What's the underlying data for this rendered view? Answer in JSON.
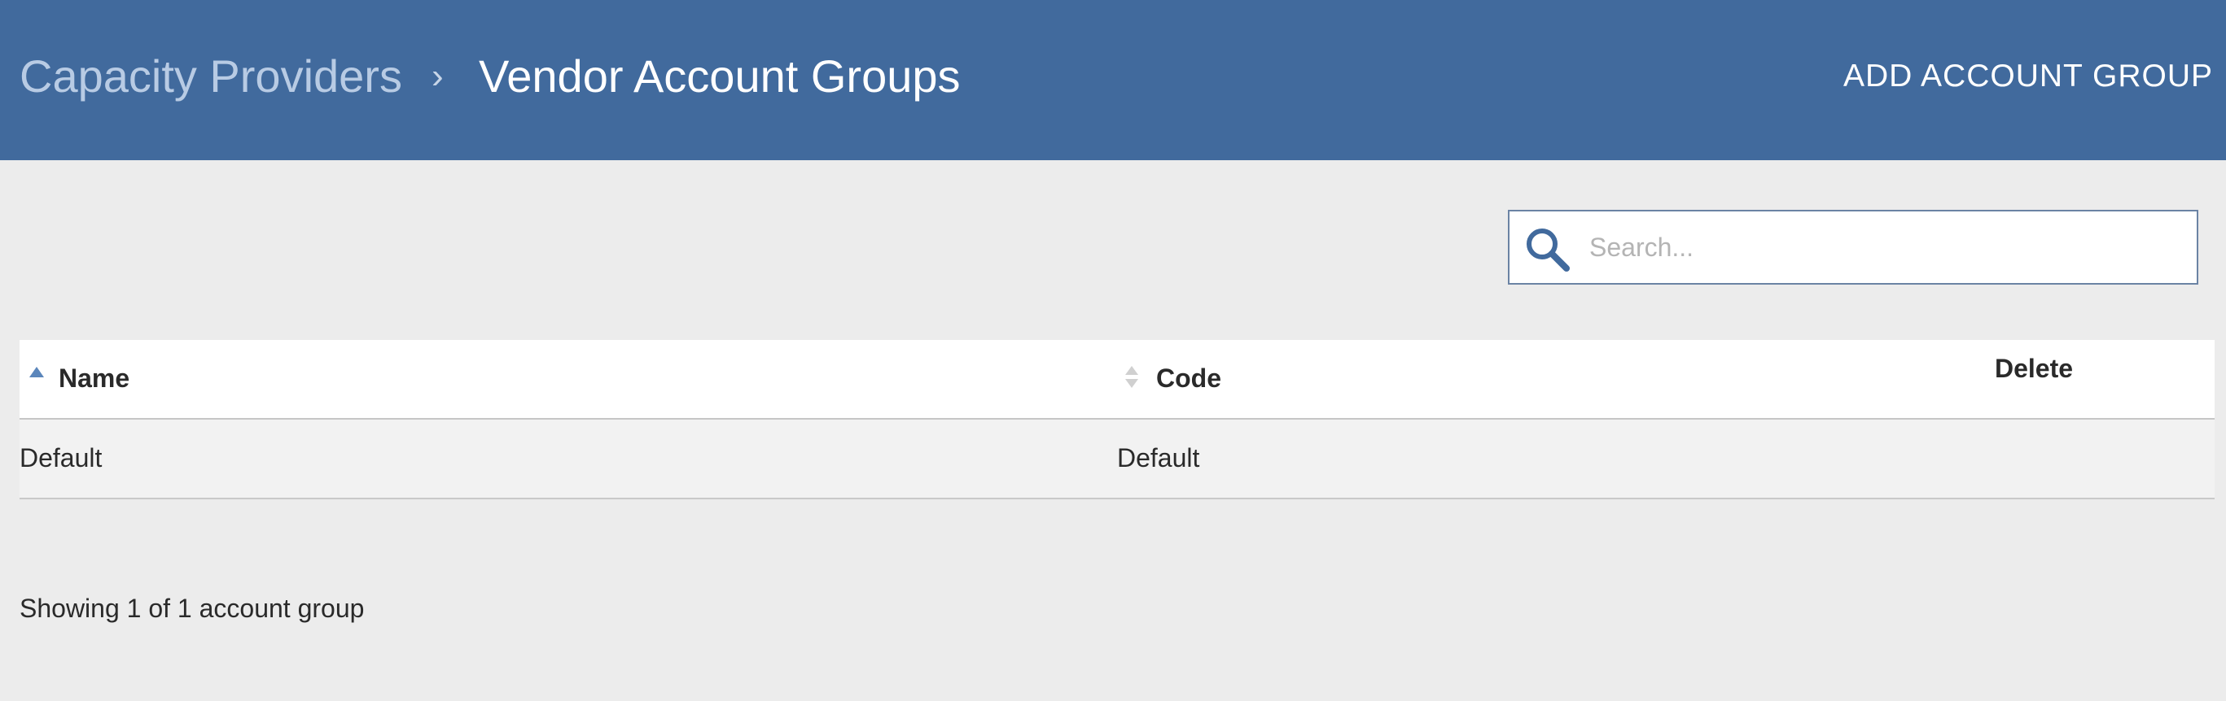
{
  "header": {
    "breadcrumb_root": "Capacity Providers",
    "breadcrumb_separator": "›",
    "page_title": "Vendor Account Groups",
    "add_button_label": "ADD ACCOUNT GROUP",
    "background_color": "#416a9d"
  },
  "search": {
    "placeholder": "Search...",
    "value": "",
    "icon": "search-icon"
  },
  "table": {
    "columns": [
      {
        "label": "Name",
        "sort": "ascending"
      },
      {
        "label": "Code",
        "sort": "sortable"
      },
      {
        "label": "Delete",
        "sort": "none"
      }
    ],
    "rows": [
      {
        "name": "Default",
        "code": "Default"
      }
    ]
  },
  "footer": {
    "summary": "Showing 1 of 1 account group"
  }
}
